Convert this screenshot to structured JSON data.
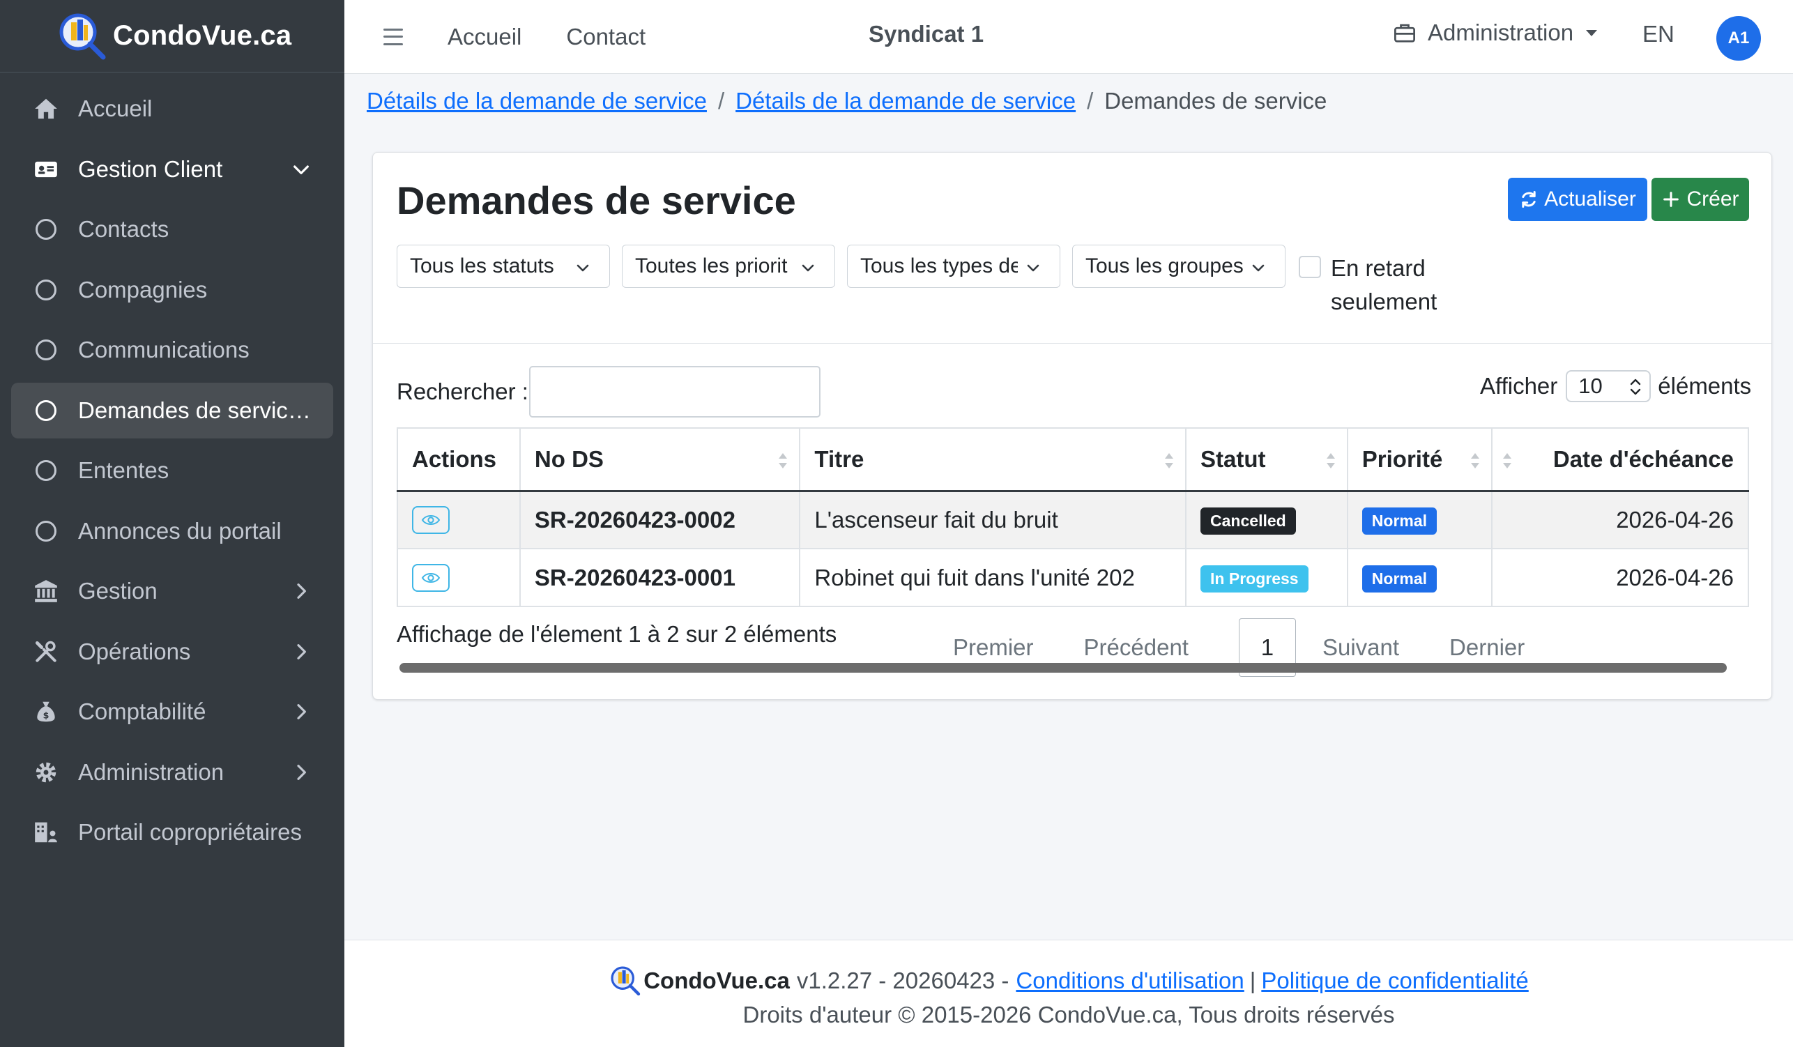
{
  "brand": {
    "name": "CondoVue.ca"
  },
  "sidebar": {
    "items": [
      {
        "label": "Accueil",
        "icon": "home-icon"
      },
      {
        "label": "Gestion Client",
        "icon": "id-card-icon"
      },
      {
        "label": "Contacts",
        "icon": "circle-icon"
      },
      {
        "label": "Compagnies",
        "icon": "circle-icon"
      },
      {
        "label": "Communications",
        "icon": "circle-icon"
      },
      {
        "label": "Demandes de service...",
        "icon": "circle-icon"
      },
      {
        "label": "Ententes",
        "icon": "circle-icon"
      },
      {
        "label": "Annonces du portail",
        "icon": "circle-icon"
      },
      {
        "label": "Gestion",
        "icon": "bank-icon"
      },
      {
        "label": "Opérations",
        "icon": "tools-icon"
      },
      {
        "label": "Comptabilité",
        "icon": "money-bag-icon"
      },
      {
        "label": "Administration",
        "icon": "gear-icon"
      },
      {
        "label": "Portail copropriétaires",
        "icon": "building-users-icon"
      }
    ]
  },
  "topbar": {
    "home": "Accueil",
    "contact": "Contact",
    "syndicat": "Syndicat 1",
    "admin": "Administration",
    "lang": "EN",
    "avatar": "A1"
  },
  "breadcrumb": {
    "first": "Détails de la demande de service",
    "second": "Détails de la demande de service",
    "current": "Demandes de service",
    "separator": "/"
  },
  "card": {
    "title": "Demandes de service",
    "refresh_label": "Actualiser",
    "create_label": "Créer"
  },
  "filters": {
    "status": "Tous les statuts",
    "priority": "Toutes les priorit",
    "type": "Tous les types de",
    "group": "Tous les groupes",
    "overdue_line1": "En retard",
    "overdue_line2": "seulement"
  },
  "search": {
    "label": "Rechercher :",
    "value": ""
  },
  "length": {
    "prefix": "Afficher",
    "value": "10",
    "suffix": "éléments"
  },
  "table": {
    "headers": [
      "Actions",
      "No DS",
      "Titre",
      "Statut",
      "Priorité",
      "Date d'échéance"
    ],
    "rows": [
      {
        "id": "SR-20260423-0002",
        "title": "L'ascenseur fait du bruit",
        "status": "Cancelled",
        "priority": "Normal",
        "due": "2026-04-26"
      },
      {
        "id": "SR-20260423-0001",
        "title": "Robinet qui fuit dans l'unité 202",
        "status": "In Progress",
        "priority": "Normal",
        "due": "2026-04-26"
      }
    ]
  },
  "pagination": {
    "info": "Affichage de l'élement 1 à 2 sur 2 éléments",
    "first": "Premier",
    "prev": "Précédent",
    "current": "1",
    "next": "Suivant",
    "last": "Dernier"
  },
  "footer": {
    "brand": "CondoVue.ca",
    "version": "v1.2.27 - 20260423 -",
    "terms": "Conditions d'utilisation",
    "pipe": "|",
    "privacy": "Politique de confidentialité",
    "copyright": "Droits d'auteur © 2015-2026 CondoVue.ca, Tous droits réservés"
  },
  "colors": {
    "sidebar_bg": "#343a40",
    "primary": "#1e76ee",
    "success": "#28874a",
    "info": "#3ec2ee",
    "dark": "#212529"
  }
}
